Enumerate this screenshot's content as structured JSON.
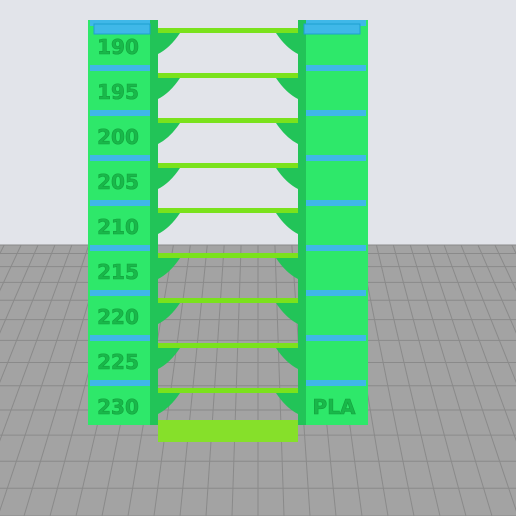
{
  "viewport": {
    "background_color": "#e2e4ea",
    "floor_color": "#a3a3a3",
    "floor_grid_color": "#8a8a8a"
  },
  "model": {
    "wall_color": "#2ee86a",
    "wall_shade_color": "#22c458",
    "bridge_color": "#7ae21c",
    "block_top_color": "#3fb8e8",
    "base_color": "#86e02a",
    "label_color": "#19b84a",
    "temperature_labels": [
      "190",
      "195",
      "200",
      "205",
      "210",
      "215",
      "220",
      "225",
      "230"
    ],
    "material_label": "PLA"
  }
}
